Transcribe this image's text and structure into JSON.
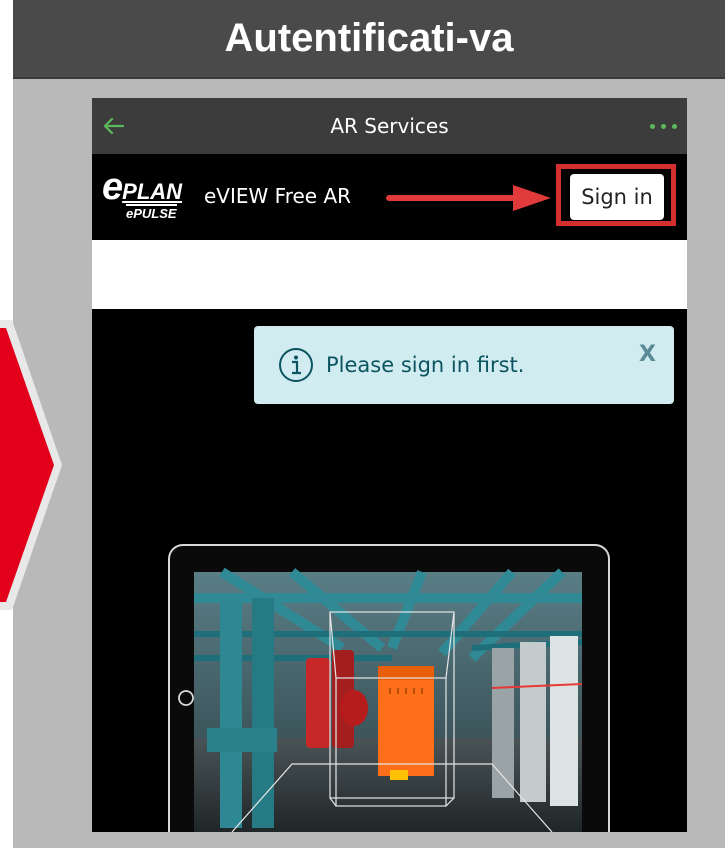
{
  "slide": {
    "title": "Autentificati-va"
  },
  "app_bar": {
    "title": "AR Services",
    "back_icon": "arrow-left-icon",
    "menu_icon": "more-dots-icon",
    "accent_color": "#5cb85c"
  },
  "brand": {
    "logo_main": "e",
    "logo_rest": "PLAN",
    "logo_sub": "ePULSE",
    "name": "eVIEW Free AR"
  },
  "sign_in": {
    "label": "Sign in",
    "highlight_color": "#d32f2f"
  },
  "alert": {
    "message": "Please sign in first.",
    "close_label": "X",
    "icon": "info-icon",
    "background": "#d1ecf1"
  },
  "illustration": {
    "icon": "tablet-ar-boiler-room-illustration"
  }
}
